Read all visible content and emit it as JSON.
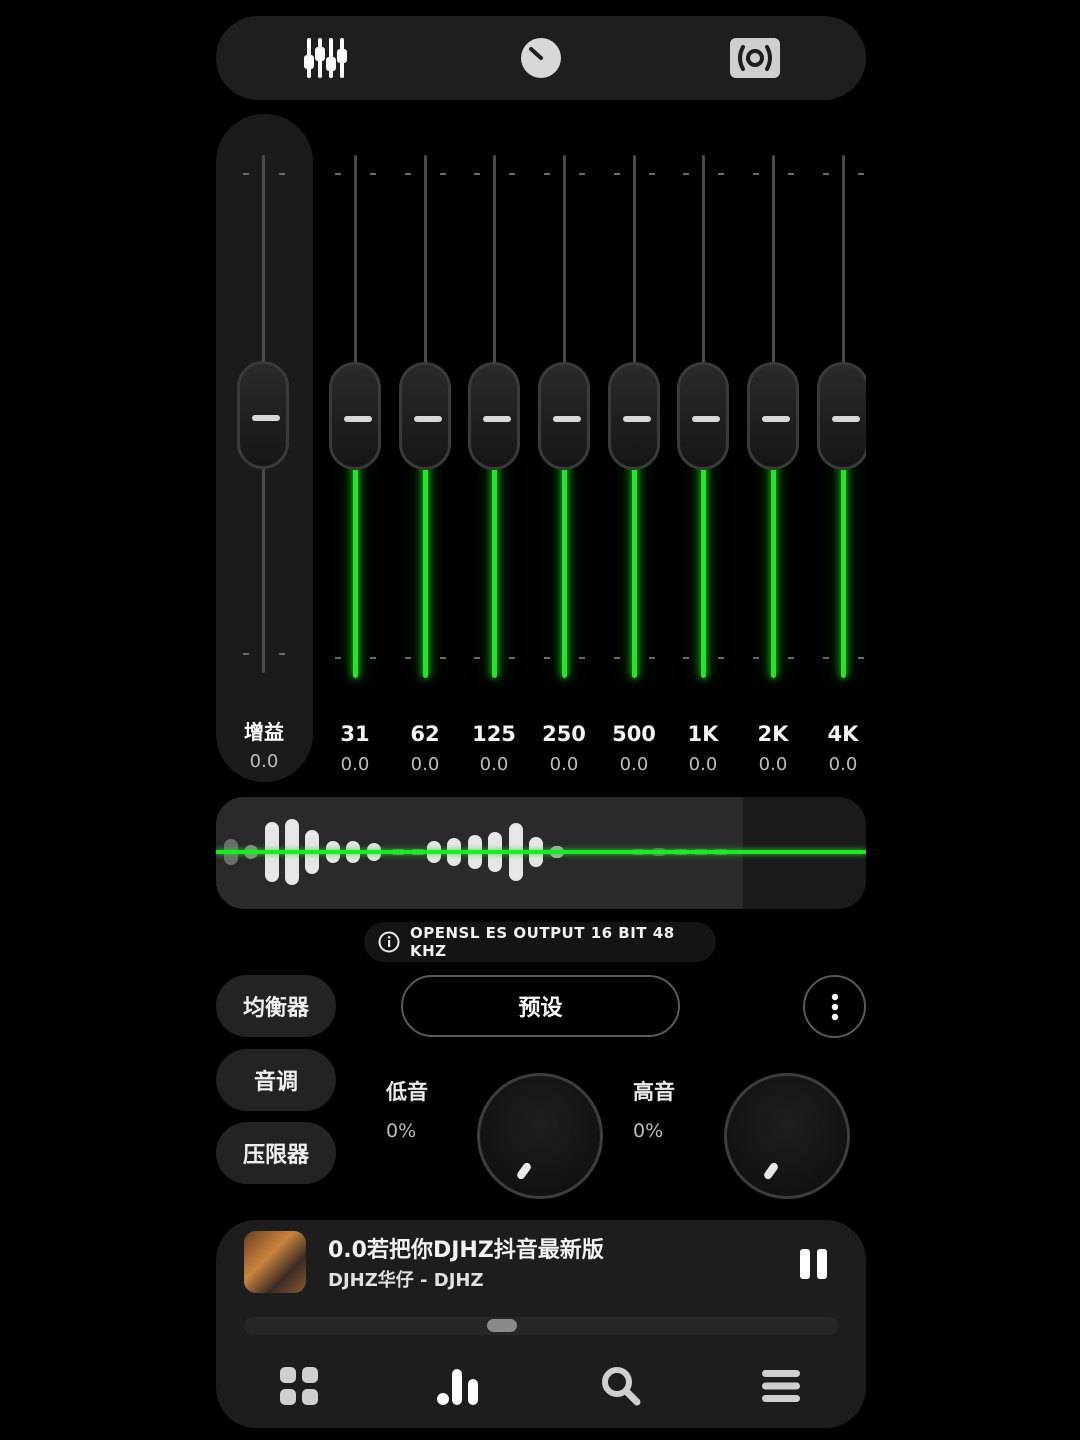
{
  "top_tabs": {
    "icons": [
      "equalizer-sliders-icon",
      "knob-icon",
      "speaker-surround-icon"
    ]
  },
  "gain": {
    "label": "增益",
    "value": "0.0",
    "level": 0.5
  },
  "bands": [
    {
      "freq": "31",
      "value": "0.0",
      "level": 0.5
    },
    {
      "freq": "62",
      "value": "0.0",
      "level": 0.5
    },
    {
      "freq": "125",
      "value": "0.0",
      "level": 0.5
    },
    {
      "freq": "250",
      "value": "0.0",
      "level": 0.5
    },
    {
      "freq": "500",
      "value": "0.0",
      "level": 0.5
    },
    {
      "freq": "1K",
      "value": "0.0",
      "level": 0.5
    },
    {
      "freq": "2K",
      "value": "0.0",
      "level": 0.5
    },
    {
      "freq": "4K",
      "value": "0.0",
      "level": 0.5
    }
  ],
  "output": {
    "text": "OPENSL ES OUTPUT  16 BIT  48 KHZ",
    "icon": "info-icon"
  },
  "side_tabs": {
    "equalizer": "均衡器",
    "tone": "音调",
    "limiter": "压限器"
  },
  "preset": {
    "label": "预设"
  },
  "more": {
    "icon": "more-vertical-icon"
  },
  "bass": {
    "label": "低音",
    "value": "0%"
  },
  "treble": {
    "label": "高音",
    "value": "0%"
  },
  "player": {
    "title": "0.0若把你DJHZ抖音最新版",
    "artist": "DJHZ华仔 - DJHZ",
    "progress": 0.43,
    "played_fraction": 0.81
  },
  "colors": {
    "accent": "#22e62a",
    "background": "#000000",
    "panel": "#1c1c1c"
  },
  "bottom_nav": [
    "grid-icon",
    "equalizer-bars-icon",
    "search-icon",
    "menu-icon"
  ]
}
